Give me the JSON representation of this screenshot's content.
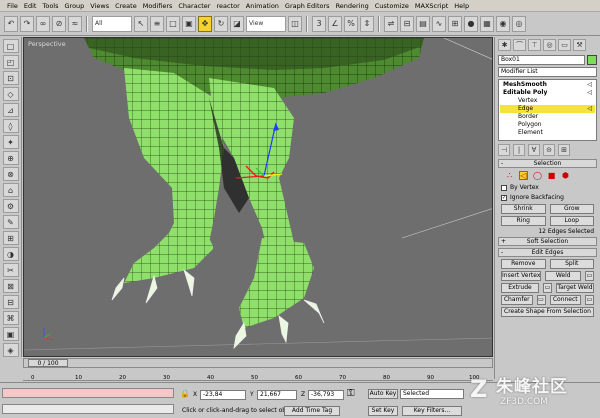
{
  "menu": [
    "File",
    "Edit",
    "Tools",
    "Group",
    "Views",
    "Create",
    "Modifiers",
    "Character",
    "reactor",
    "Animation",
    "Graph Editors",
    "Rendering",
    "Customize",
    "MAXScript",
    "Help"
  ],
  "toolbar": {
    "selection_filter": "All",
    "ref_coord": "View"
  },
  "viewport": {
    "label": "Perspective"
  },
  "command_panel": {
    "object_name": "Box01",
    "object_color": "#7fdc5a",
    "modifier_list": "Modifier List",
    "stack": [
      {
        "label": "MeshSmooth",
        "level": 1,
        "selected": false
      },
      {
        "label": "Editable Poly",
        "level": 1,
        "selected": false
      },
      {
        "label": "Vertex",
        "level": 2,
        "selected": false
      },
      {
        "label": "Edge",
        "level": 2,
        "selected": true
      },
      {
        "label": "Border",
        "level": 2,
        "selected": false
      },
      {
        "label": "Polygon",
        "level": 2,
        "selected": false
      },
      {
        "label": "Element",
        "level": 2,
        "selected": false
      }
    ],
    "selection": {
      "title": "Selection",
      "by_vertex": "By Vertex",
      "ignore_backfacing": "Ignore Backfacing",
      "shrink": "Shrink",
      "grow": "Grow",
      "ring": "Ring",
      "loop": "Loop",
      "info": "12 Edges Selected"
    },
    "soft_selection": {
      "title": "Soft Selection"
    },
    "edit_edges": {
      "title": "Edit Edges",
      "remove": "Remove",
      "split": "Split",
      "insert_vertex": "Insert Vertex",
      "weld": "Weld",
      "extrude": "Extrude",
      "target_weld": "Target Weld",
      "chamfer": "Chamfer",
      "connect": "Connect",
      "create_shape": "Create Shape From Selection"
    }
  },
  "timeline": {
    "frame": "0 / 100",
    "ticks": [
      "0",
      "10",
      "20",
      "30",
      "40",
      "50",
      "60",
      "70",
      "80",
      "90",
      "100"
    ]
  },
  "status": {
    "x": "-23,84",
    "y": "21,667",
    "z": "-36,793",
    "hint": "Click or click-and-drag to select obj",
    "add_time_tag": "Add Time Tag",
    "auto_key": "Auto Key",
    "set_key": "Set Key",
    "selected": "Selected",
    "key_filters": "Key Filters..."
  },
  "watermark": {
    "text": "朱峰社区",
    "url": "ZF3D.COM"
  }
}
